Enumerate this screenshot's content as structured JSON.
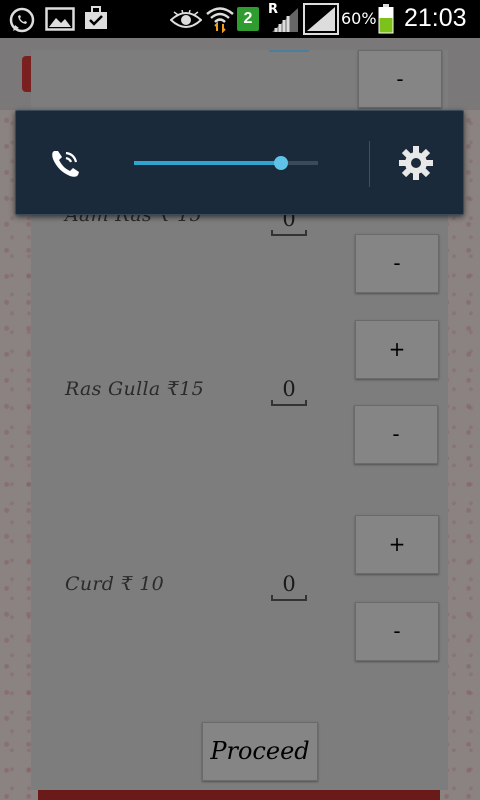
{
  "status_bar": {
    "data_badge": "2",
    "roaming": "R",
    "battery_percent": "60%",
    "clock": "21:03",
    "battery_level": 0.6
  },
  "volume_panel": {
    "level": 0.8,
    "accent_color": "#2fa4cf"
  },
  "menu": {
    "items": [
      {
        "label": "Aam Ras  ₹ 15",
        "quantity": "0",
        "minus_label": "-"
      },
      {
        "label": "Ras Gulla  ₹15",
        "quantity": "0",
        "plus_label": "+",
        "minus_label": "-"
      },
      {
        "label": "Curd  ₹ 10",
        "quantity": "0",
        "plus_label": "+",
        "minus_label": "-"
      }
    ],
    "top_minus_label": "-",
    "proceed_label": "Proceed"
  }
}
